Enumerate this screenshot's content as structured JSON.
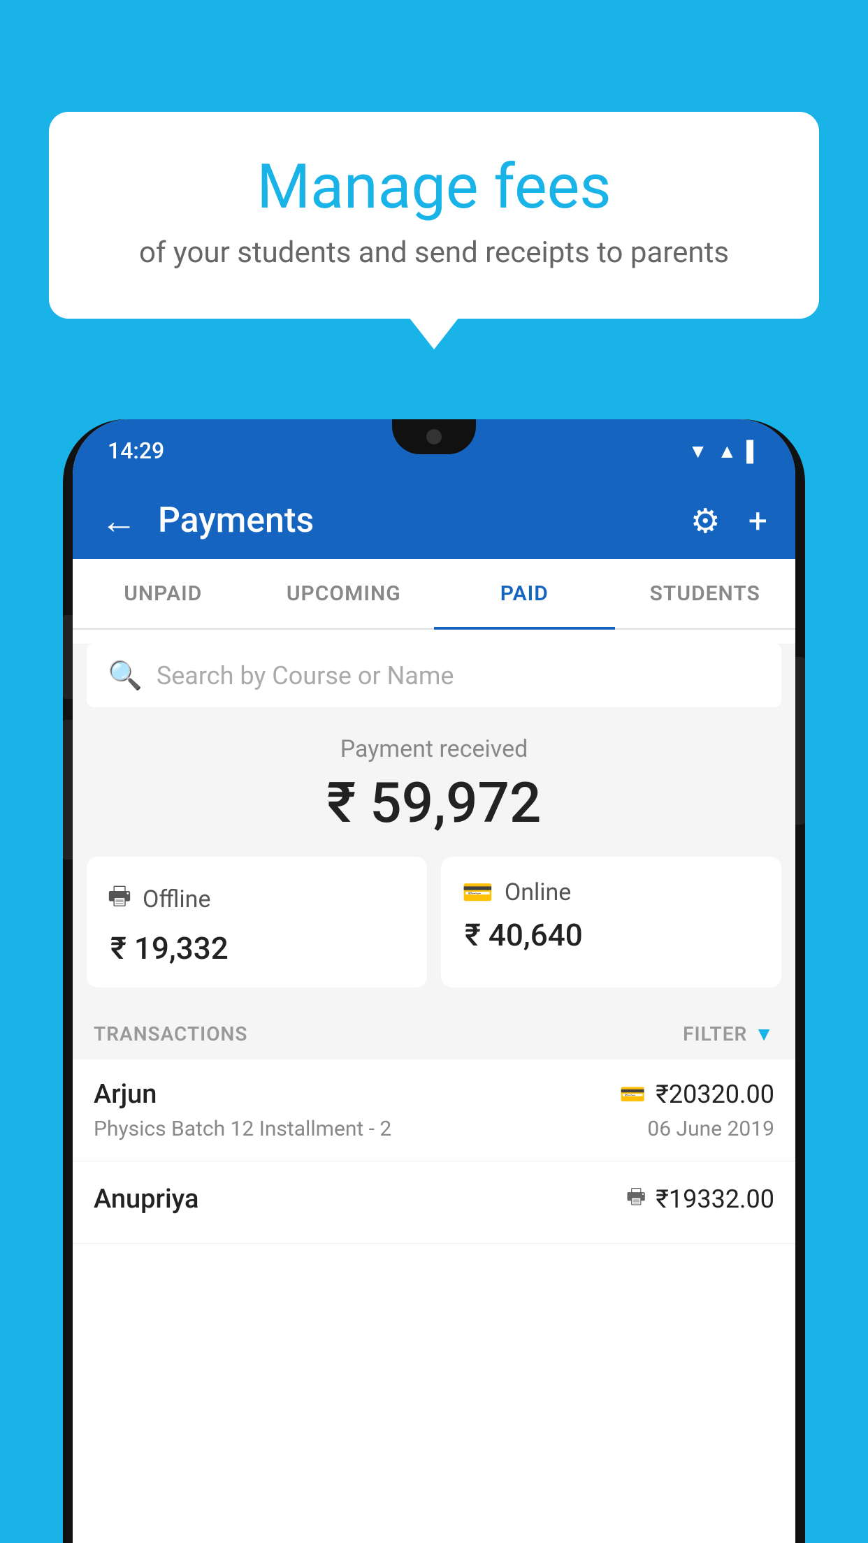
{
  "background_color": "#1ab3e8",
  "bubble": {
    "title": "Manage fees",
    "subtitle": "of your students and send receipts to parents"
  },
  "phone": {
    "status": {
      "time": "14:29",
      "signal_icon": "▲",
      "wifi_icon": "▼",
      "battery_icon": "▌"
    },
    "app_bar": {
      "title": "Payments",
      "back_label": "←",
      "settings_label": "⚙",
      "add_label": "+"
    },
    "tabs": [
      {
        "label": "UNPAID",
        "active": false
      },
      {
        "label": "UPCOMING",
        "active": false
      },
      {
        "label": "PAID",
        "active": true
      },
      {
        "label": "STUDENTS",
        "active": false
      }
    ],
    "search": {
      "placeholder": "Search by Course or Name"
    },
    "payment_summary": {
      "label": "Payment received",
      "amount": "₹ 59,972"
    },
    "payment_cards": [
      {
        "type": "Offline",
        "amount": "₹ 19,332",
        "icon": "offline"
      },
      {
        "type": "Online",
        "amount": "₹ 40,640",
        "icon": "online"
      }
    ],
    "transactions_header": {
      "label": "TRANSACTIONS",
      "filter_label": "FILTER"
    },
    "transactions": [
      {
        "name": "Arjun",
        "description": "Physics Batch 12 Installment - 2",
        "amount": "₹20320.00",
        "date": "06 June 2019",
        "payment_type": "online"
      },
      {
        "name": "Anupriya",
        "description": "",
        "amount": "₹19332.00",
        "date": "",
        "payment_type": "offline"
      }
    ]
  }
}
